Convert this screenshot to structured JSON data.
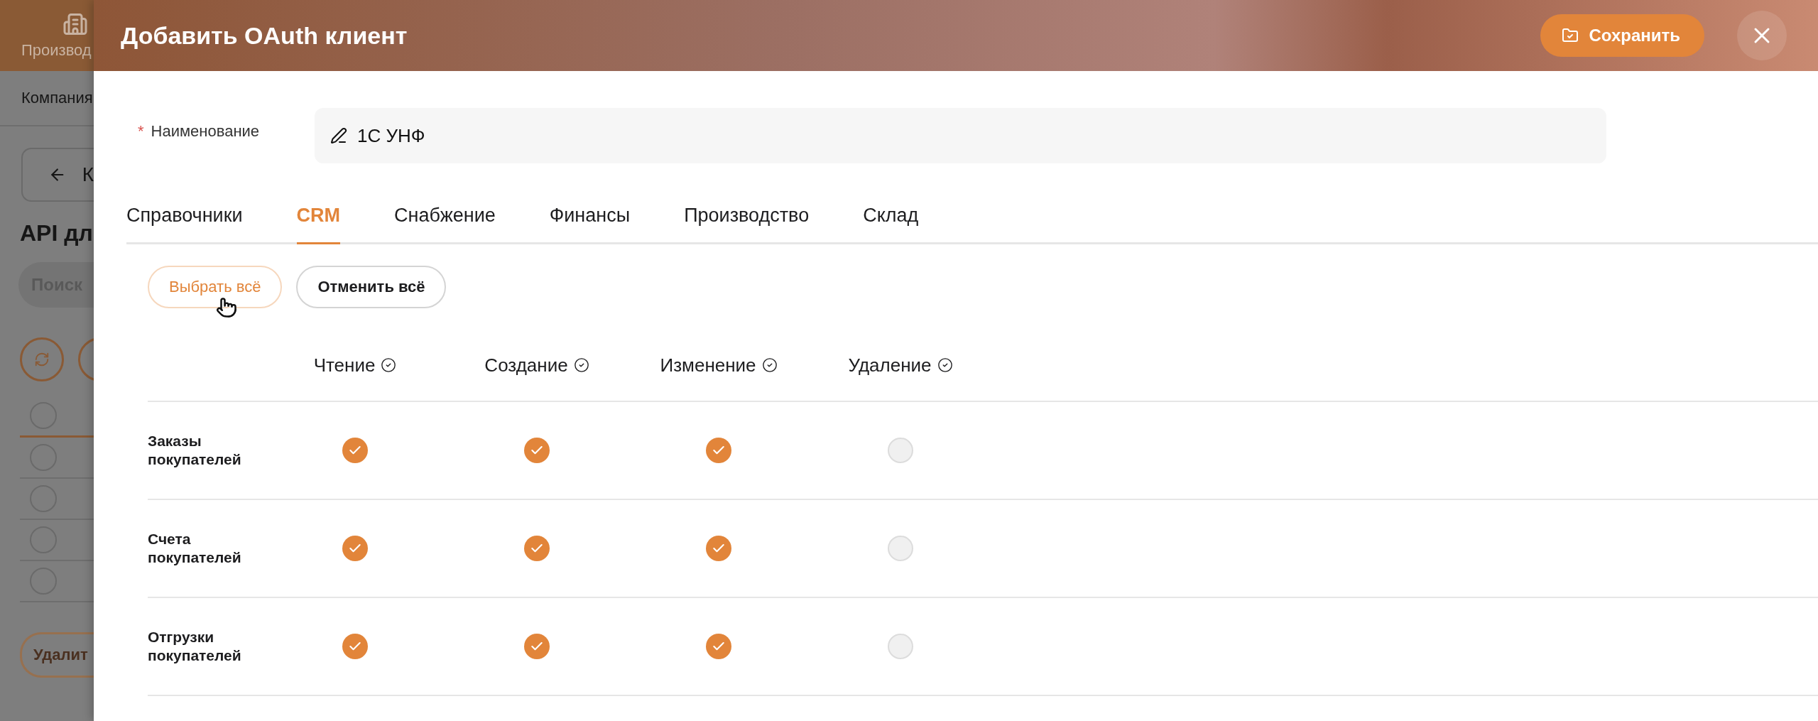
{
  "background_page": {
    "nav_label": "Производ",
    "breadcrumb": "Компания",
    "back_button": "К",
    "heading": "API дл",
    "search_placeholder": "Поиск",
    "header_checked": false,
    "table_rows": [
      {
        "checked": false
      },
      {
        "checked": false
      },
      {
        "checked": false
      },
      {
        "checked": false
      }
    ],
    "delete_button": "Удалит"
  },
  "drawer": {
    "title": "Добавить OAuth клиент",
    "save_button": "Сохранить"
  },
  "name_field": {
    "label": "Наименование",
    "required_mark": "*",
    "value": "1С УНФ"
  },
  "tabs": [
    {
      "label": "Справочники",
      "selected": false
    },
    {
      "label": "CRM",
      "selected": true
    },
    {
      "label": "Снабжение",
      "selected": false
    },
    {
      "label": "Финансы",
      "selected": false
    },
    {
      "label": "Производство",
      "selected": false
    },
    {
      "label": "Склад",
      "selected": false
    }
  ],
  "actions": [
    {
      "label": "Выбрать всё",
      "kind": "primary"
    },
    {
      "label": "Отменить всё",
      "kind": "secondary"
    }
  ],
  "permissions": {
    "columns": [
      "Чтение",
      "Создание",
      "Изменение",
      "Удаление"
    ],
    "rows": [
      {
        "name": "Заказы покупателей",
        "checked": [
          true,
          true,
          true,
          false
        ]
      },
      {
        "name": "Счета покупателей",
        "checked": [
          true,
          true,
          true,
          false
        ]
      },
      {
        "name": "Отгрузки покупателей",
        "checked": [
          true,
          true,
          true,
          false
        ]
      }
    ]
  }
}
